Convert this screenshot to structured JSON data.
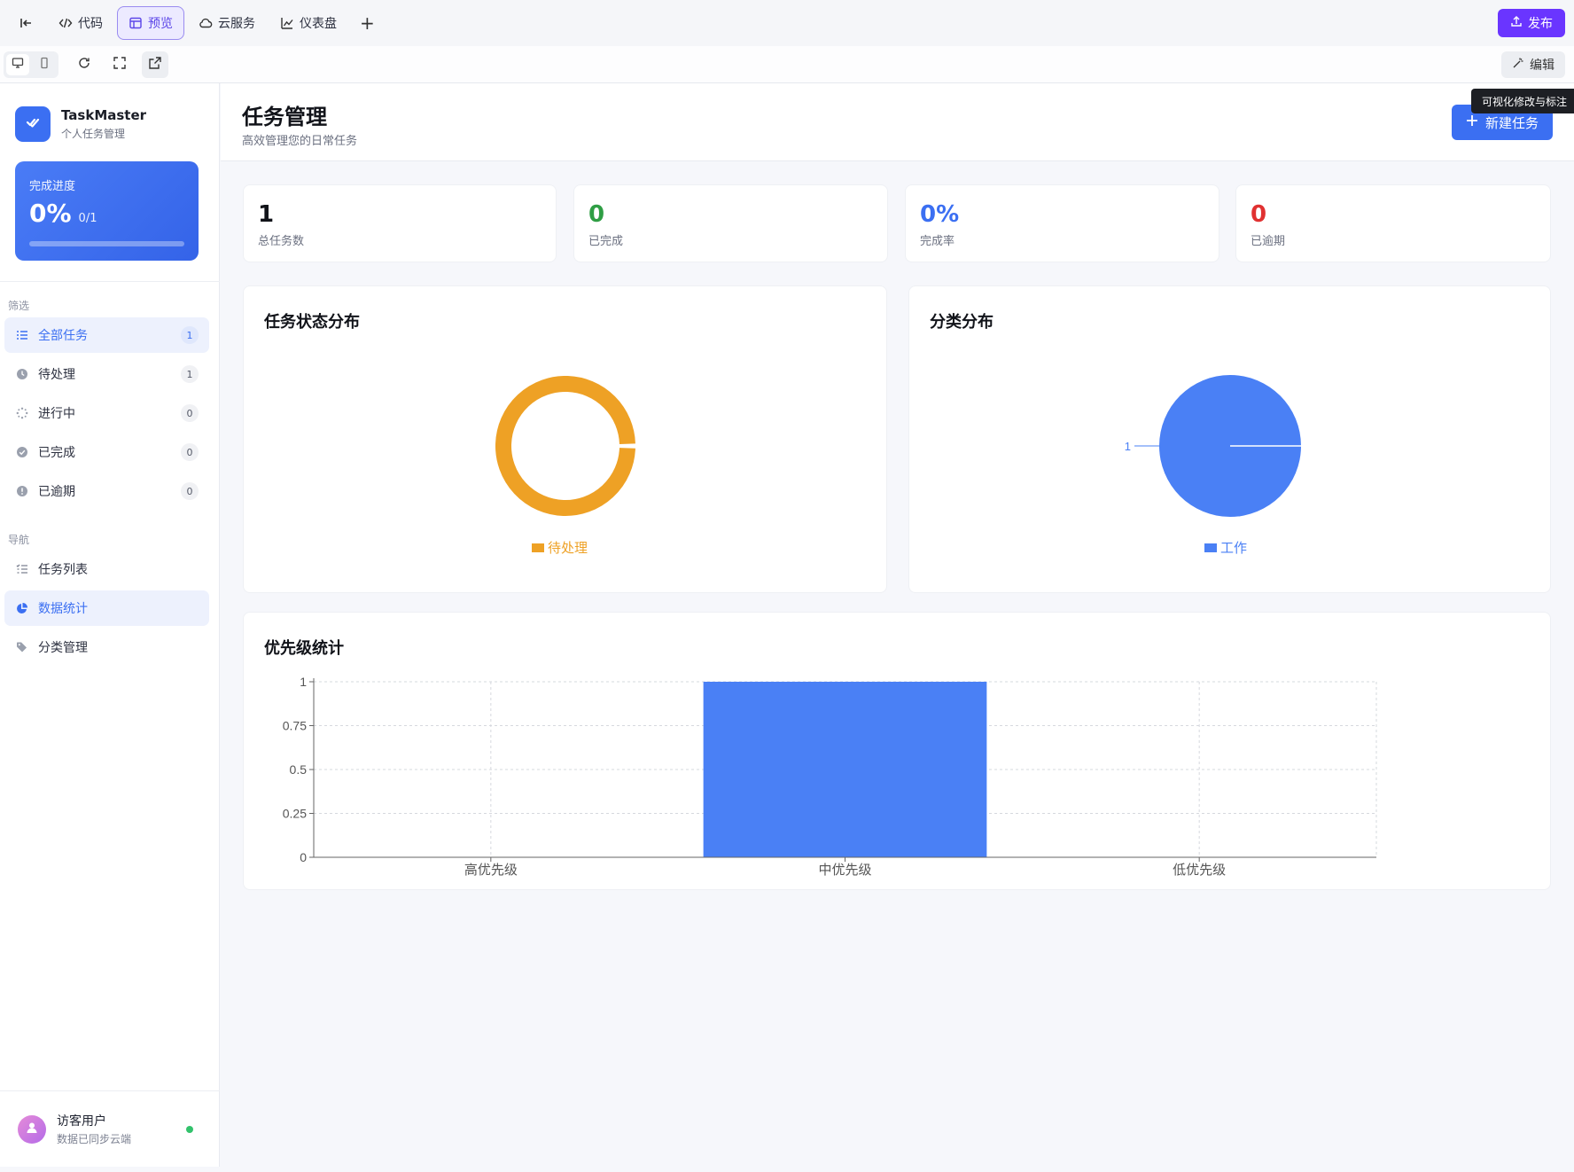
{
  "toolbar": {
    "tabs": [
      {
        "label": "代码",
        "icon": "code-icon"
      },
      {
        "label": "预览",
        "icon": "layout-icon",
        "active": true
      },
      {
        "label": "云服务",
        "icon": "cloud-icon"
      },
      {
        "label": "仪表盘",
        "icon": "chart-icon"
      }
    ],
    "publish_label": "发布",
    "edit_label": "编辑",
    "tooltip": "可视化修改与标注"
  },
  "sidebar": {
    "app_name": "TaskMaster",
    "app_sub": "个人任务管理",
    "progress": {
      "label": "完成进度",
      "value": "0%",
      "count": "0/1",
      "fraction": 0
    },
    "filter_title": "筛选",
    "filters": [
      {
        "label": "全部任务",
        "count": "1",
        "icon": "list-icon",
        "active": true
      },
      {
        "label": "待处理",
        "count": "1",
        "icon": "clock-icon"
      },
      {
        "label": "进行中",
        "count": "0",
        "icon": "spinner-icon"
      },
      {
        "label": "已完成",
        "count": "0",
        "icon": "check-circle-icon"
      },
      {
        "label": "已逾期",
        "count": "0",
        "icon": "alert-icon"
      }
    ],
    "nav_title": "导航",
    "nav": [
      {
        "label": "任务列表",
        "icon": "tasks-icon"
      },
      {
        "label": "数据统计",
        "icon": "pie-icon",
        "active": true
      },
      {
        "label": "分类管理",
        "icon": "tag-icon"
      }
    ],
    "user": {
      "name": "访客用户",
      "sub": "数据已同步云端"
    }
  },
  "main": {
    "title": "任务管理",
    "subtitle": "高效管理您的日常任务",
    "new_task_label": "新建任务",
    "stats": [
      {
        "value": "1",
        "label": "总任务数",
        "color": "#111319"
      },
      {
        "value": "0",
        "label": "已完成",
        "color": "#2f9e44"
      },
      {
        "value": "0%",
        "label": "完成率",
        "color": "#3b6ff2"
      },
      {
        "value": "0",
        "label": "已逾期",
        "color": "#e03131"
      }
    ]
  },
  "colors": {
    "accent": "#3b6ff2",
    "pending": "#eea125",
    "work": "#4a80f5",
    "publish": "#6a35ff"
  },
  "chart_data": [
    {
      "type": "pie",
      "title": "任务状态分布",
      "donut": true,
      "series": [
        {
          "name": "待处理",
          "values": [
            1
          ]
        }
      ],
      "categories": [
        "待处理"
      ],
      "color": "#eea125"
    },
    {
      "type": "pie",
      "title": "分类分布",
      "categories": [
        "工作"
      ],
      "values": [
        1
      ],
      "data_labels": [
        "1"
      ],
      "color": "#4a80f5"
    },
    {
      "type": "bar",
      "title": "优先级统计",
      "categories": [
        "高优先级",
        "中优先级",
        "低优先级"
      ],
      "values": [
        0,
        1,
        0
      ],
      "ylim": [
        0,
        1
      ],
      "yticks": [
        "0",
        "0.25",
        "0.5",
        "0.75",
        "1"
      ],
      "grid": true,
      "color": "#4a80f5"
    }
  ]
}
